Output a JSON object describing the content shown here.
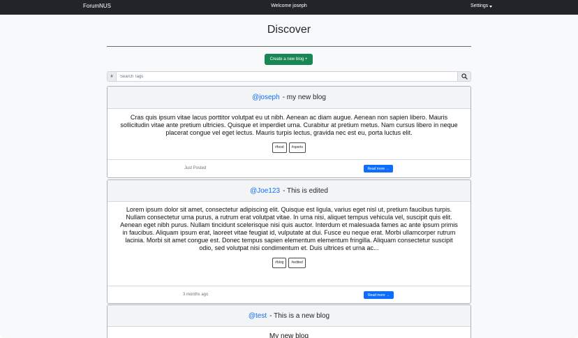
{
  "navbar": {
    "brand": "ForumNUS",
    "welcome": "Welcome joseph",
    "settings": "Settings"
  },
  "main": {
    "title": "Discover",
    "create_button": "Create a new blog +",
    "search": {
      "hash": "#",
      "placeholder": "Search Tags",
      "value": ""
    }
  },
  "posts": [
    {
      "author": "@joseph",
      "title": "- my new blog",
      "body": "Cras quis ipsum vitae lacus porttitor volutpat eu ut nibh. Aenean ac diam augue. Aenean non sapien libero. Mauris sollicitudin vitae ante pretium ultricies. Quisque et imperdiet urna. Curabitur at pretium metus. Nam cursus libero in neque placerat congue vel eget lectus. Mauris turpis lectus, gravida nec est eu, porta luctus elit.",
      "tags": [
        "#food",
        "#sports"
      ],
      "posted": "Just Posted",
      "read_more": "Read more →"
    },
    {
      "author": "@Joe123",
      "title": "- This is edited",
      "body": "Lorem ipsum dolor sit amet, consectetur adipiscing elit. Quisque est ligula, varius eget nisl ut, pretium faucibus turpis. Nullam consectetur urna purus, a rutrum erat volutpat vitae. In urna nisi, aliquet tempus vehicula vel, suscipit quis elit. Aenean eget nibh purus. Nullam tincidunt scelerisque nisi quis auctor. Interdum et malesuada fames ac ante ipsum primis in faucibus. Aliquam ipsum erat, laoreet vitae feugiat id, vulputate at dui. Fusce eu neque erat. Morbi ullamcorper rutrum lacinia. Morbi sit amet congue est. Donec tempus sapien elementum elementum fringilla. Aliquam consectetur suscipit odio, sed volutpat nisi condimentum et. Duis ultrices et urna ac...",
      "tags": [
        "#blog",
        "#edited"
      ],
      "posted": "3 months ago",
      "read_more": "Read more →"
    },
    {
      "author": "@test",
      "title": "- This is a new blog",
      "body": "My new blog"
    }
  ]
}
